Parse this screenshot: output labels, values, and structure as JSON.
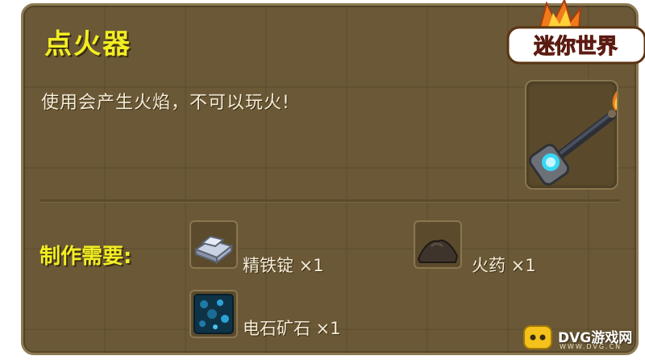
{
  "item": {
    "title": "点火器",
    "description": "使用会产生火焰，不可以玩火!"
  },
  "recipe": {
    "label": "制作需要:",
    "materials": [
      {
        "name": "精铁锭 ×1",
        "icon": "iron-ingot-icon"
      },
      {
        "name": "火药 ×1",
        "icon": "gunpowder-icon"
      },
      {
        "name": "电石矿石 ×1",
        "icon": "carbide-ore-icon"
      }
    ]
  },
  "logo": {
    "text": "迷你世界"
  },
  "watermark": {
    "text": "DVG游戏网",
    "sub": "WWW.DVG.CN"
  },
  "colors": {
    "panel": "#6a5836",
    "title": "#f2ee23",
    "text": "#f4ecd8",
    "accent_flame": "#f07a1c",
    "accent_glow": "#38d8f4"
  }
}
